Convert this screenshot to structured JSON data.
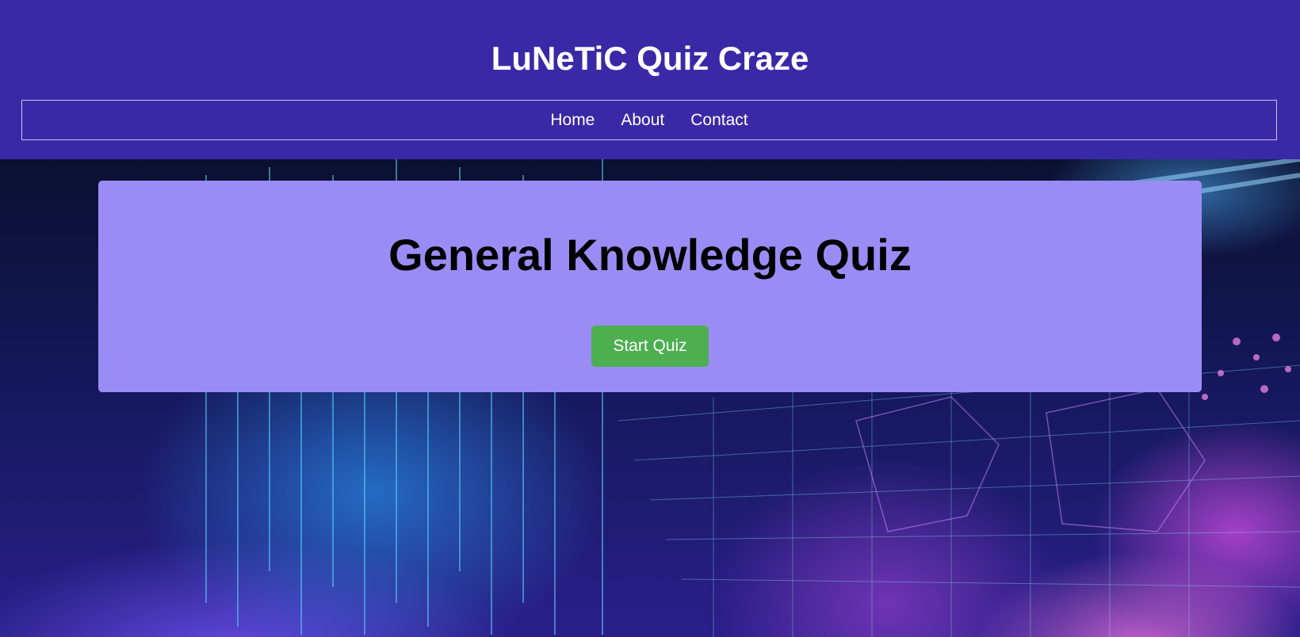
{
  "header": {
    "site_title": "LuNeTiC Quiz Craze",
    "nav": [
      {
        "label": "Home"
      },
      {
        "label": "About"
      },
      {
        "label": "Contact"
      }
    ]
  },
  "main": {
    "quiz_title": "General Knowledge Quiz",
    "start_button_label": "Start Quiz"
  },
  "colors": {
    "header_bg": "#3a29a6",
    "card_bg": "#9b8cf5",
    "button_bg": "#4caf50",
    "text_light": "#ffffff",
    "text_dark": "#000000"
  }
}
